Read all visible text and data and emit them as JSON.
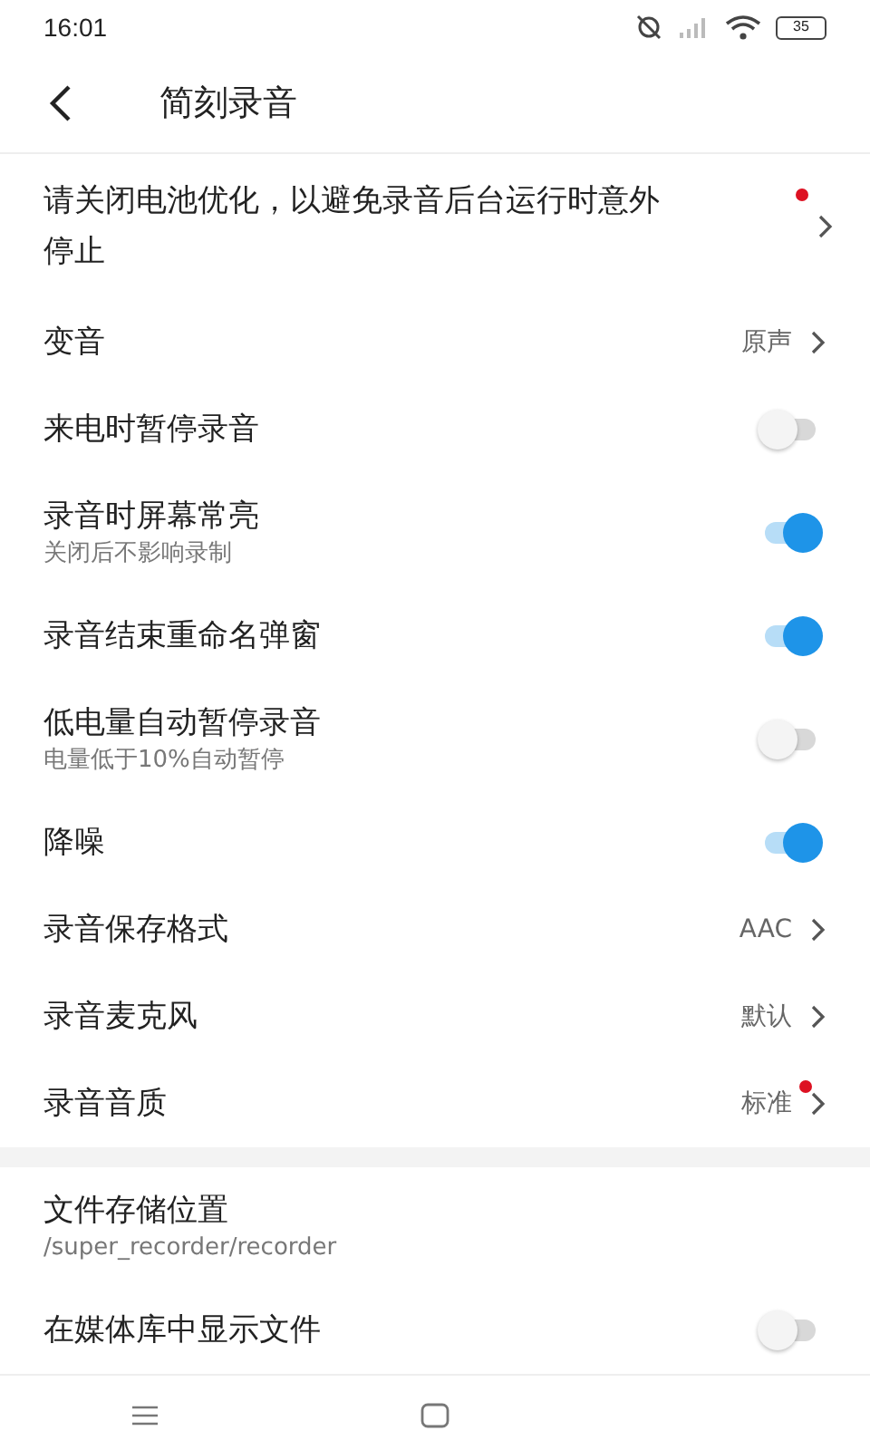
{
  "status_bar": {
    "time": "16:01",
    "battery": "35"
  },
  "header": {
    "title": "简刻录音"
  },
  "sections": [
    {
      "items": [
        {
          "kind": "nav",
          "title": "请关闭电池优化，以避免录音后台运行时意外停止",
          "dot": true
        },
        {
          "kind": "nav",
          "title": "变音",
          "value": "原声",
          "dot": false
        },
        {
          "kind": "toggle",
          "title": "来电时暂停录音",
          "on": false
        },
        {
          "kind": "toggle",
          "title": "录音时屏幕常亮",
          "subtitle": "关闭后不影响录制",
          "on": true
        },
        {
          "kind": "toggle",
          "title": "录音结束重命名弹窗",
          "on": true
        },
        {
          "kind": "toggle",
          "title": "低电量自动暂停录音",
          "subtitle": "电量低于10%自动暂停",
          "on": false
        },
        {
          "kind": "toggle",
          "title": "降噪",
          "on": true
        },
        {
          "kind": "nav",
          "title": "录音保存格式",
          "value": "AAC",
          "dot": false
        },
        {
          "kind": "nav",
          "title": "录音麦克风",
          "value": "默认",
          "dot": false
        },
        {
          "kind": "nav",
          "title": "录音音质",
          "value": "标准",
          "dot": true
        }
      ]
    },
    {
      "items": [
        {
          "kind": "info",
          "title": "文件存储位置",
          "subtitle": "/super_recorder/recorder"
        },
        {
          "kind": "toggle",
          "title": "在媒体库中显示文件",
          "on": false
        }
      ]
    }
  ]
}
